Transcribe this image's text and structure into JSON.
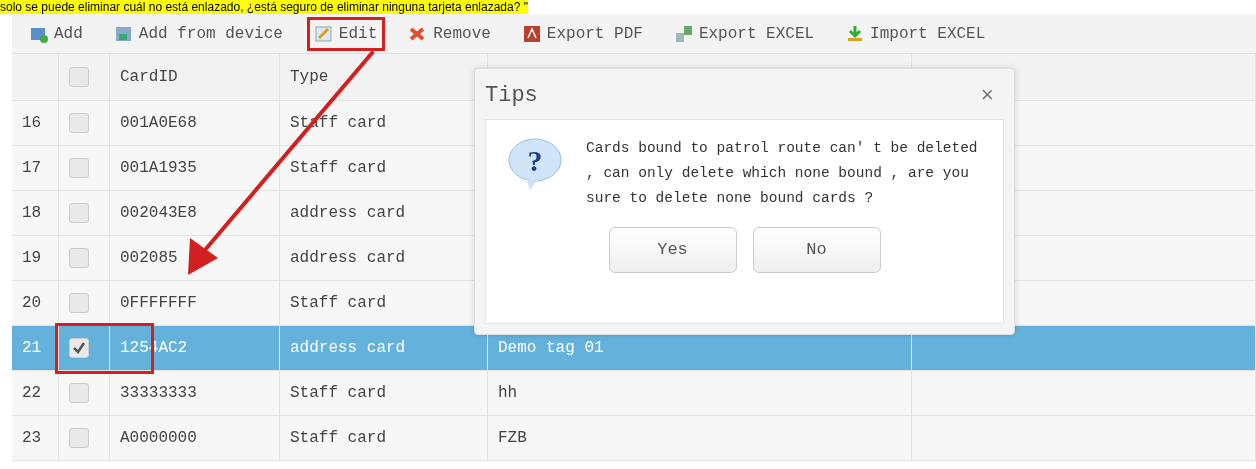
{
  "caption": "solo se puede eliminar cuál no está enlazado, ¿está seguro de eliminar ninguna tarjeta enlazada? \"",
  "toolbar": [
    {
      "label": "Add",
      "kind": "add"
    },
    {
      "label": "Add from device",
      "kind": "device"
    },
    {
      "label": "Edit",
      "kind": "edit"
    },
    {
      "label": "Remove",
      "kind": "remove"
    },
    {
      "label": "Export PDF",
      "kind": "pdf"
    },
    {
      "label": "Export EXCEL",
      "kind": "excel"
    },
    {
      "label": "Import EXCEL",
      "kind": "import"
    }
  ],
  "table": {
    "columns": [
      "CardID",
      "Type"
    ],
    "all_checked": false,
    "rows": [
      {
        "number": "16",
        "checked": false,
        "selected": false,
        "card_id": "001A0E68",
        "type": "Staff card"
      },
      {
        "number": "17",
        "checked": false,
        "selected": false,
        "card_id": "001A1935",
        "type": "Staff card"
      },
      {
        "number": "18",
        "checked": false,
        "selected": false,
        "card_id": "002043E8",
        "type": "address card"
      },
      {
        "number": "19",
        "checked": false,
        "selected": false,
        "card_id": "002085",
        "type": "address card"
      },
      {
        "number": "20",
        "checked": false,
        "selected": false,
        "card_id": "0FFFFFFF",
        "type": "Staff card"
      },
      {
        "number": "21",
        "checked": true,
        "selected": true,
        "card_id": "1254AC2",
        "type": "address card",
        "column_4": "Demo tag 01"
      },
      {
        "number": "22",
        "checked": false,
        "selected": false,
        "card_id": "33333333",
        "type": "Staff card",
        "column_4": "hh"
      },
      {
        "number": "23",
        "checked": false,
        "selected": false,
        "card_id": "A0000000",
        "type": "Staff card",
        "column_4": "FZB"
      }
    ]
  },
  "dialog": {
    "title": "Tips",
    "close": "×",
    "icon_glyph": "?",
    "message": "Cards bound to patrol route can' t be deleted , can only delete which none bound , are you sure to delete none bound cards ?",
    "buttons": [
      "Yes",
      "No"
    ]
  }
}
